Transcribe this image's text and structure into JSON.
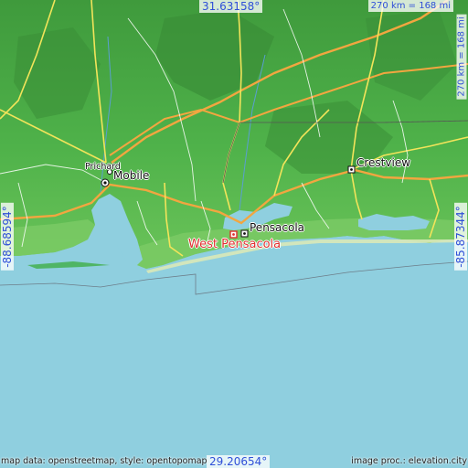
{
  "map": {
    "colors": {
      "water": "#8fcfdf",
      "land": "#4fb24a",
      "upland": "#3f9a3c",
      "coast": "#86cf6b",
      "highway": "#f2a640",
      "road": "#f2e45a",
      "minor_road": "#ffffff",
      "accent": "#2f4fd8",
      "highlight": "#e0302f"
    },
    "coordinates": {
      "north": "31.63158°",
      "south": "29.20654°",
      "west": "-88.68594°",
      "east": "-85.87344°"
    },
    "scale": {
      "horizontal": "270 km = 168 mi",
      "vertical": "270 km = 168 mi"
    },
    "attribution": {
      "left": "map data: openstreetmap, style: opentopomap",
      "right": "image proc.: elevation.city"
    },
    "places": {
      "prichard": "Prichard",
      "mobile": "Mobile",
      "pensacola": "Pensacola",
      "crestview": "Crestview",
      "west_pensacola": "West Pensacola"
    },
    "icons": {
      "city_marker": "city-marker-icon",
      "highlight_marker": "highlight-marker-icon"
    }
  }
}
